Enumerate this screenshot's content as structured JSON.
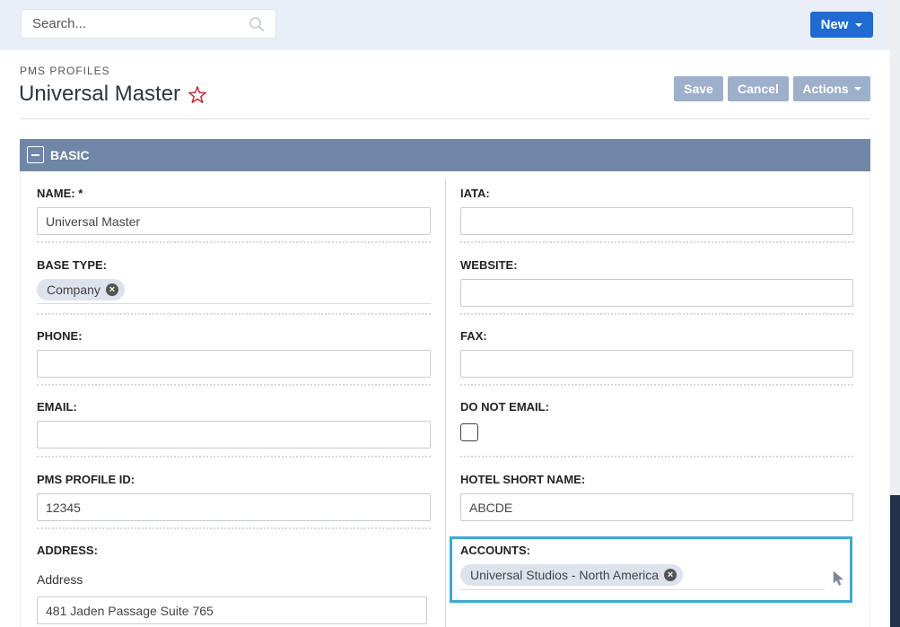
{
  "search": {
    "placeholder": "Search..."
  },
  "new_button": {
    "label": "New"
  },
  "header": {
    "module": "PMS PROFILES",
    "title": "Universal Master",
    "save_label": "Save",
    "cancel_label": "Cancel",
    "actions_label": "Actions"
  },
  "panel": {
    "title": "BASIC"
  },
  "fields": {
    "name": {
      "label": "NAME:",
      "required": "*",
      "value": "Universal Master"
    },
    "base_type": {
      "label": "BASE TYPE:",
      "value": "Company"
    },
    "phone": {
      "label": "PHONE:",
      "value": ""
    },
    "email": {
      "label": "EMAIL:",
      "value": ""
    },
    "pms_profile_id": {
      "label": "PMS PROFILE ID:",
      "value": "12345"
    },
    "address": {
      "label": "ADDRESS:",
      "sub_label": "Address",
      "value": "481 Jaden Passage Suite 765"
    },
    "iata": {
      "label": "IATA:",
      "value": ""
    },
    "website": {
      "label": "WEBSITE:",
      "value": ""
    },
    "fax": {
      "label": "FAX:",
      "value": ""
    },
    "do_not_email": {
      "label": "DO NOT EMAIL:",
      "checked": false
    },
    "hotel_short_name": {
      "label": "HOTEL SHORT NAME:",
      "value": "ABCDE"
    },
    "accounts": {
      "label": "ACCOUNTS:",
      "value": "Universal Studios - North America"
    }
  },
  "colors": {
    "primary": "#1f6bd1",
    "panel_header": "#6f86a6",
    "header_buttons": "#9dafca",
    "focus_outline": "#3ea7d8",
    "favorite_star": "#c2283a"
  },
  "icons": {
    "search": "search-icon",
    "favorite": "star-outline-icon",
    "collapse": "minus-square-icon",
    "remove": "close-circle-icon",
    "pointer": "mouse-pointer-icon"
  }
}
